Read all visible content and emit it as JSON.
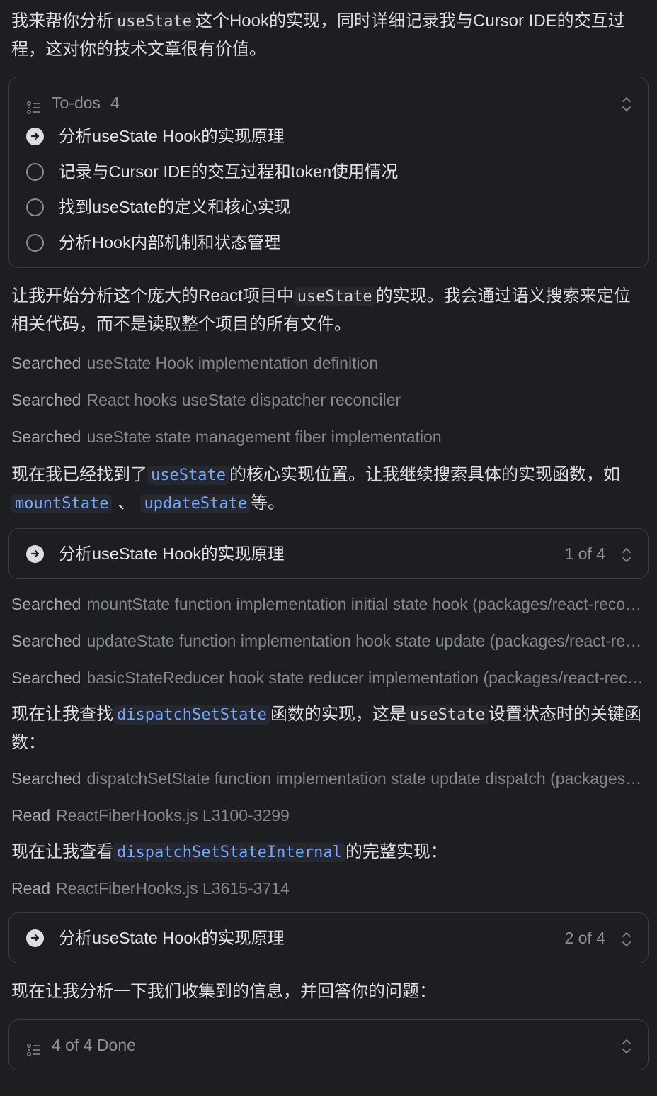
{
  "intro": {
    "part1": "我来帮你分析",
    "code1": "useState",
    "part2": "这个Hook的实现，同时详细记录我与Cursor IDE的交互过程，这对你的技术文章很有价值。"
  },
  "todo_panel": {
    "title": "To-dos",
    "count": "4",
    "items": [
      {
        "label": "分析useState Hook的实现原理",
        "status": "in-progress"
      },
      {
        "label": "记录与Cursor IDE的交互过程和token使用情况",
        "status": "pending"
      },
      {
        "label": "找到useState的定义和核心实现",
        "status": "pending"
      },
      {
        "label": "分析Hook内部机制和状态管理",
        "status": "pending"
      }
    ]
  },
  "para2": {
    "part1": "让我开始分析这个庞大的React项目中",
    "code1": "useState",
    "part2": "的实现。我会通过语义搜索来定位相关代码，而不是读取整个项目的所有文件。"
  },
  "searches1": [
    {
      "verb": "Searched",
      "detail": "useState Hook implementation definition"
    },
    {
      "verb": "Searched",
      "detail": "React hooks useState dispatcher reconciler"
    },
    {
      "verb": "Searched",
      "detail": "useState state management fiber implementation"
    }
  ],
  "para3": {
    "part1": "现在我已经找到了",
    "code1": "useState",
    "part2": "的核心实现位置。让我继续搜索具体的实现函数，如",
    "code2": "mountState",
    "part3": "、",
    "code3": "updateState",
    "part4": "等。"
  },
  "status1": {
    "label": "分析useState Hook的实现原理",
    "count": "1 of 4"
  },
  "searches2": [
    {
      "verb": "Searched",
      "detail": "mountState function implementation initial state hook (packages/react-reconciler/)"
    },
    {
      "verb": "Searched",
      "detail": "updateState function implementation hook state update (packages/react-reconciler/)"
    },
    {
      "verb": "Searched",
      "detail": "basicStateReducer hook state reducer implementation (packages/react-reconciler/)"
    }
  ],
  "para4": {
    "part1": "现在让我查找",
    "code1": "dispatchSetState",
    "part2": "函数的实现，这是",
    "code2": "useState",
    "part3": "设置状态时的关键函数："
  },
  "searches3": [
    {
      "verb": "Searched",
      "detail": "dispatchSetState function implementation state update dispatch (packages/react-reconciler/)"
    },
    {
      "verb": "Read",
      "detail": "ReactFiberHooks.js L3100-3299"
    }
  ],
  "para5": {
    "part1": "现在让我查看",
    "code1": "dispatchSetStateInternal",
    "part2": "的完整实现："
  },
  "searches4": [
    {
      "verb": "Read",
      "detail": "ReactFiberHooks.js L3615-3714"
    }
  ],
  "status2": {
    "label": "分析useState Hook的实现原理",
    "count": "2 of 4"
  },
  "para6": {
    "text": "现在让我分析一下我们收集到的信息，并回答你的问题："
  },
  "done_panel": {
    "label": "4 of 4 Done"
  }
}
